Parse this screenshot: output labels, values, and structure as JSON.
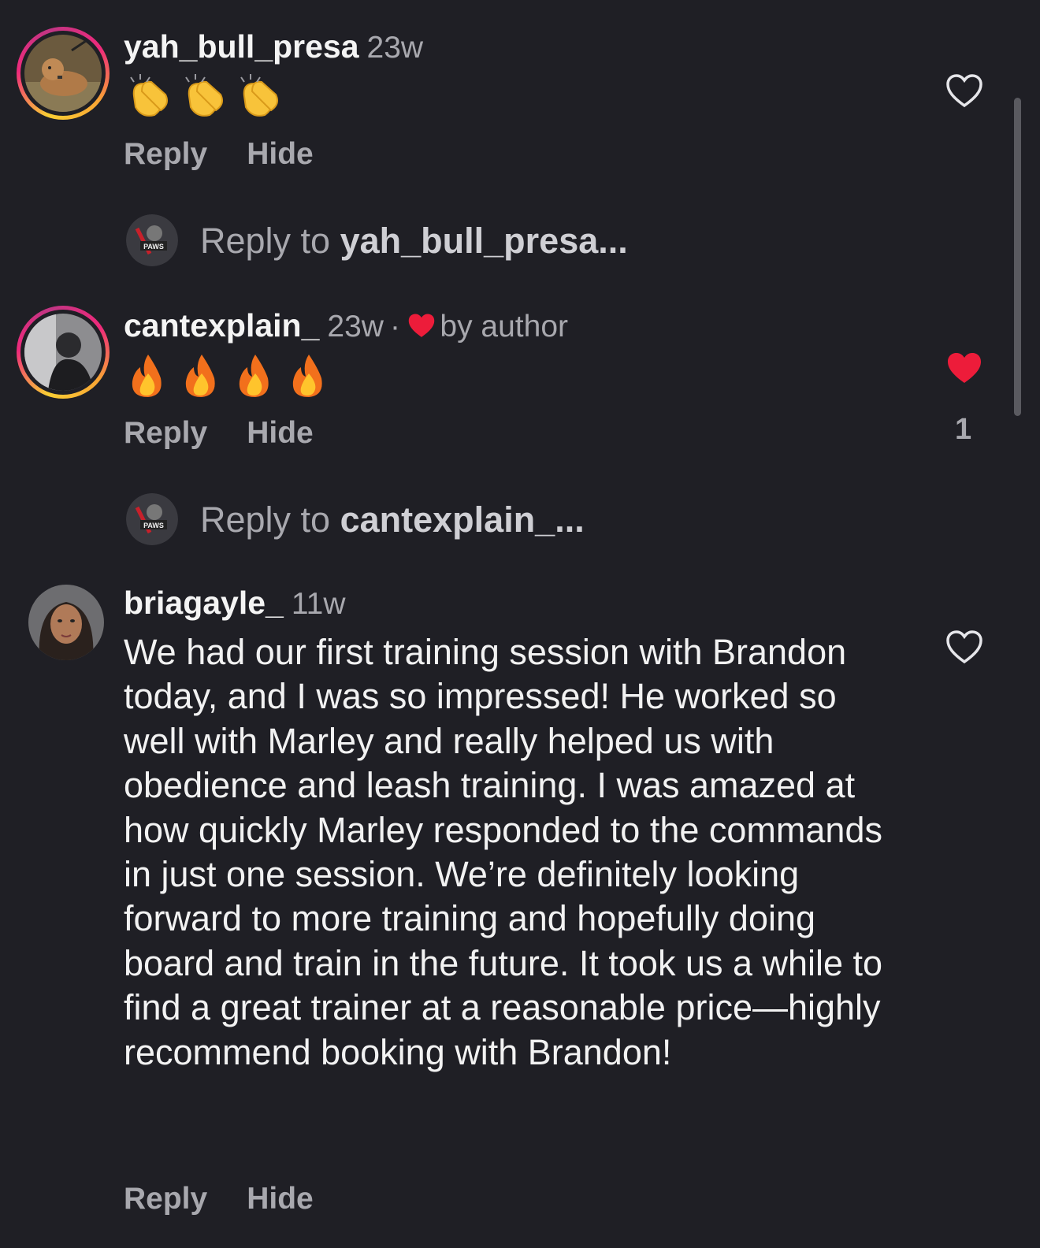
{
  "comments": [
    {
      "username": "yah_bull_presa",
      "time": "23w",
      "emoji_text": "👏👏👏",
      "reply_label": "Reply",
      "hide_label": "Hide",
      "liked": false
    },
    {
      "username": "cantexplain_",
      "time": "23w",
      "separator": "·",
      "author_badge": "by author",
      "emoji_text": "🔥🔥🔥🔥",
      "reply_label": "Reply",
      "hide_label": "Hide",
      "liked": true,
      "like_count": "1"
    },
    {
      "username": "briagayle_",
      "time": "11w",
      "text": "We had our first training session with Brandon today, and I was so impressed! He worked so well with Marley and really helped us with obedience and leash training. I was amazed at how quickly Marley responded to the commands in just one session. We’re definitely looking forward to more training and hopefully doing board and train in the future. It took us a while to find a great trainer at a reasonable price—highly recommend booking with Brandon!",
      "reply_label": "Reply",
      "hide_label": "Hide",
      "liked": false
    }
  ],
  "reply_prompts": [
    {
      "prefix": "Reply to ",
      "target": "yah_bull_presa..."
    },
    {
      "prefix": "Reply to ",
      "target": "cantexplain_..."
    }
  ],
  "mini_avatar_text": "PAWS",
  "colors": {
    "background": "#1f1f25",
    "secondary_text": "#a8a8ae",
    "like_red": "#ed1c3a"
  }
}
